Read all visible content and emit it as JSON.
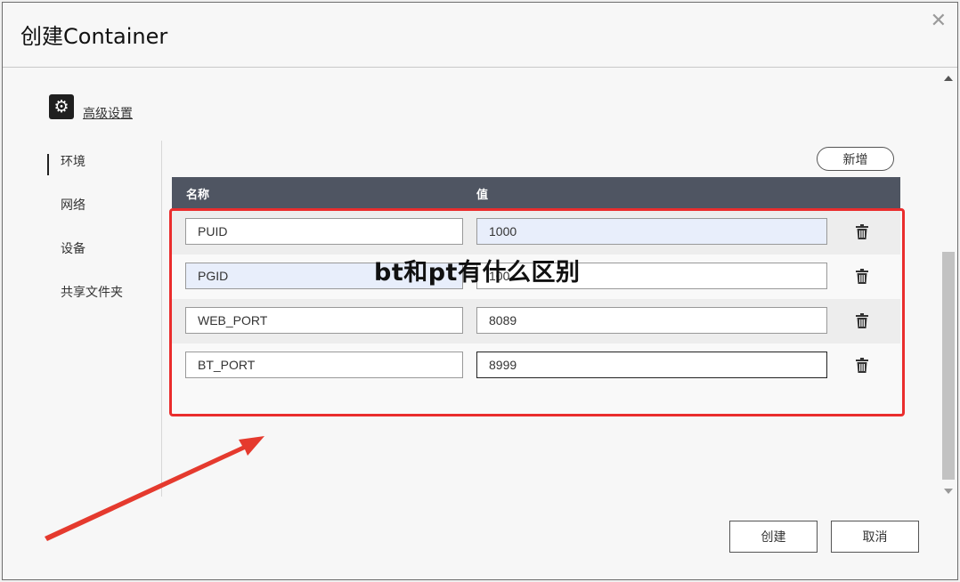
{
  "dialog": {
    "title": "创建Container",
    "close_glyph": "✕"
  },
  "advanced": {
    "icon": "gear-icon",
    "link_label": "高级设置"
  },
  "sidebar": {
    "items": [
      {
        "label": "环境",
        "active": true
      },
      {
        "label": "网络",
        "active": false
      },
      {
        "label": "设备",
        "active": false
      },
      {
        "label": "共享文件夹",
        "active": false
      }
    ]
  },
  "env": {
    "add_label": "新增",
    "columns": {
      "name": "名称",
      "value": "值"
    },
    "rows": [
      {
        "name": "PUID",
        "value": "1000"
      },
      {
        "name": "PGID",
        "value": "100"
      },
      {
        "name": "WEB_PORT",
        "value": "8089"
      },
      {
        "name": "BT_PORT",
        "value": "8999"
      }
    ]
  },
  "overlay": {
    "text": "bt和pt有什么区别"
  },
  "footer": {
    "create_label": "创建",
    "cancel_label": "取消"
  },
  "colors": {
    "annotation": "#ea2d2d",
    "table_header": "#4f5562",
    "field_highlight": "#e8eefb"
  }
}
